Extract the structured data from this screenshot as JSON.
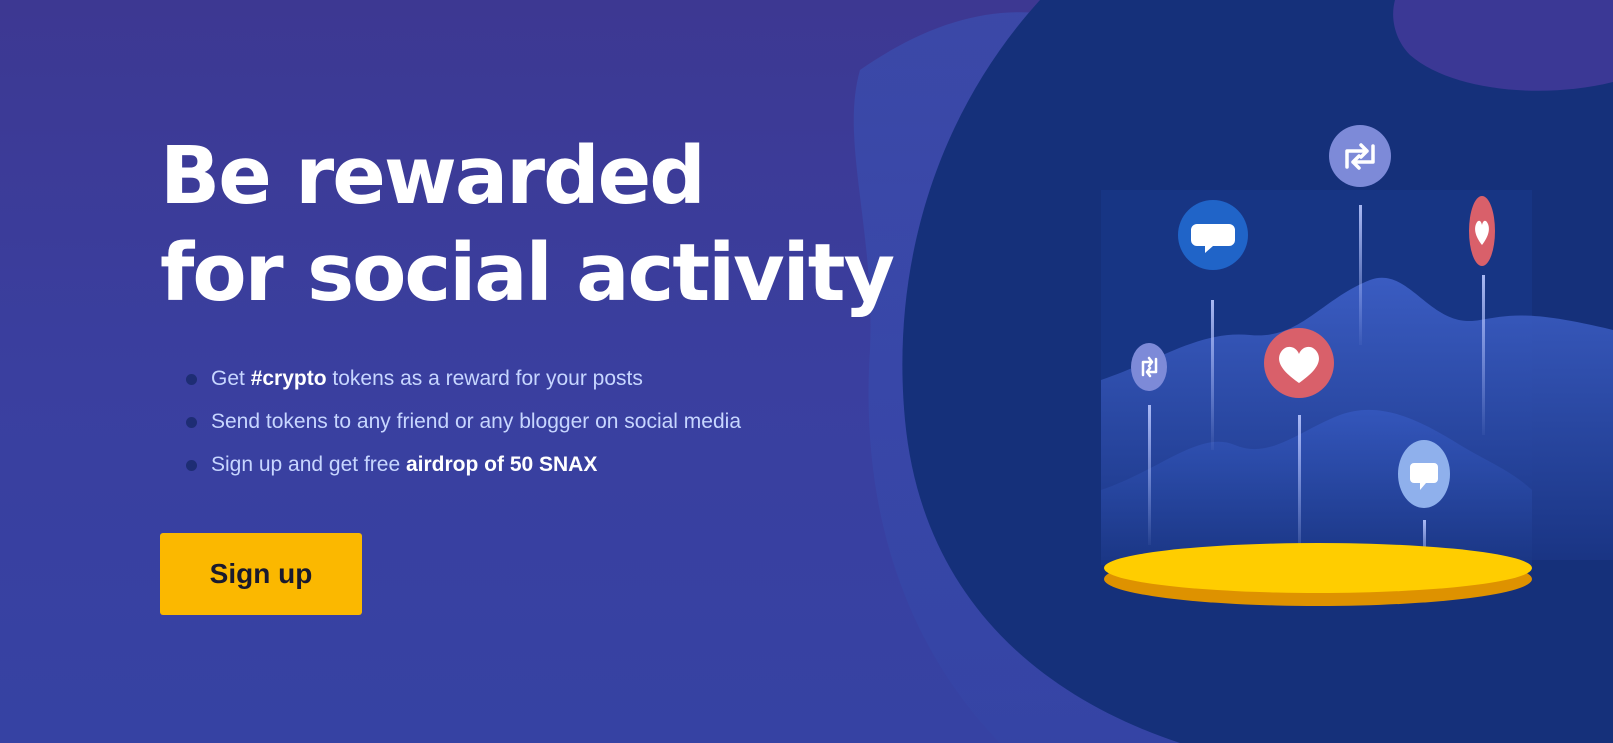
{
  "hero": {
    "headline_line1": "Be rewarded",
    "headline_line2": "for social activity",
    "features": [
      {
        "before": "Get ",
        "highlight": "#crypto",
        "after": " tokens as a reward for your posts"
      },
      {
        "before": "Send tokens to any friend or any blogger on social media",
        "highlight": "",
        "after": ""
      },
      {
        "before": "Sign up and get free ",
        "highlight": "airdrop of 50 SNAX",
        "after": ""
      }
    ],
    "signup_label": "Sign up"
  },
  "illustration": {
    "icons": [
      "comment-bubble-icon",
      "retweet-icon",
      "heart-icon"
    ],
    "colors": {
      "background": "#3a3f9f",
      "blob": "#15307a",
      "platform": "#ffcd00",
      "platform_edge": "#de9200",
      "heart_bubble": "#d9606a",
      "comment_bubble": "#2064c8",
      "retweet_bubble": "#7d8ad8",
      "cta": "#fbb800"
    }
  }
}
